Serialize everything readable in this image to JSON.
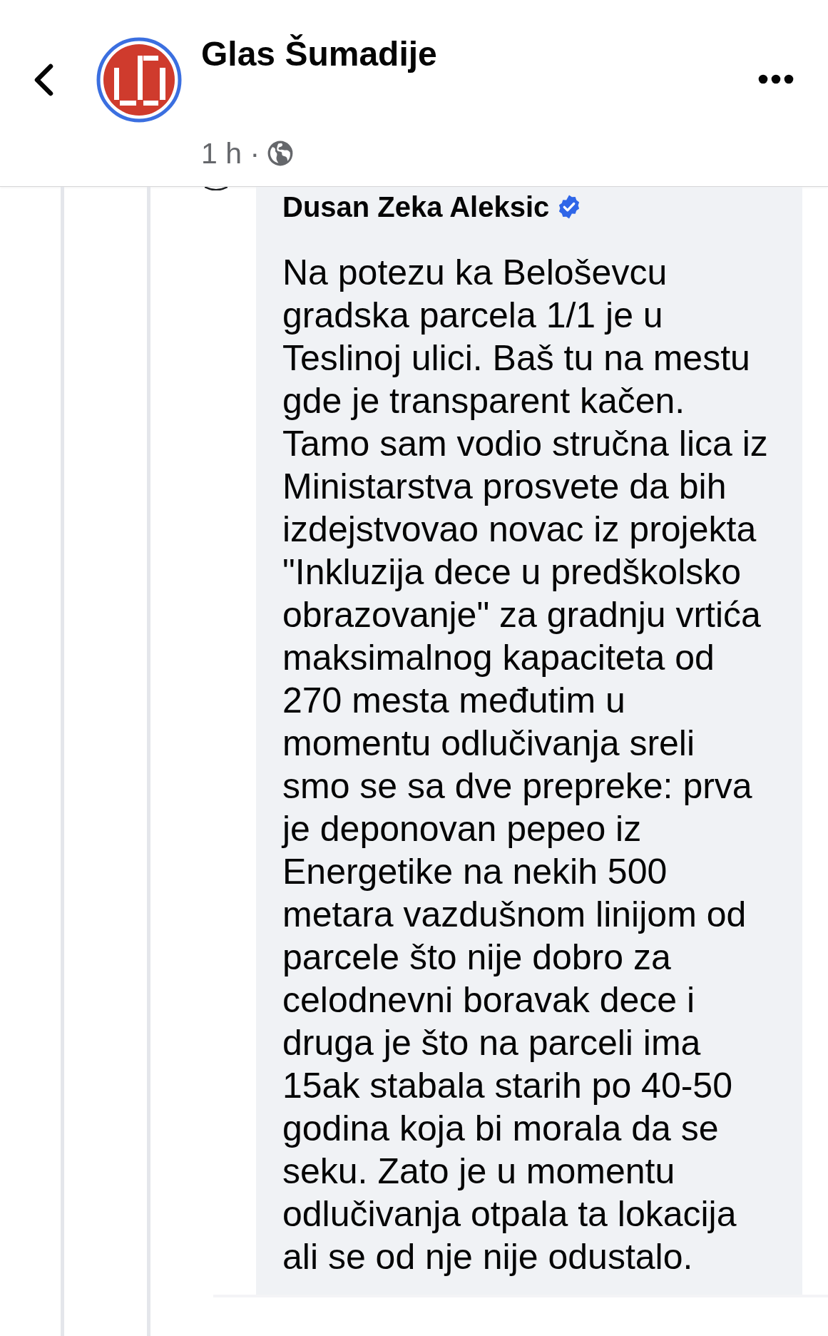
{
  "header": {
    "title": "Glas Šumadije",
    "meta": "1 h ·"
  },
  "comment": {
    "author": "Dusan Zeka Aleksic",
    "verified": true,
    "text": "Na potezu ka Beloševcu\ngradska parcela 1/1 je u\nTeslinoj ulici. Baš tu na mestu\ngde je transparent kačen.\nTamo sam vodio stručna lica iz\nMinistarstva prosvete da bih\nizdejstvovao novac iz projekta\n\"Inkluzija dece u predškolsko\nobrazovanje\" za gradnju vrtića\nmaksimalnog kapaciteta od\n270 mesta međutim u\nmomentu odlučivanja sreli\nsmo se sa dve prepreke: prva\nje deponovan pepeo iz\nEnergetike na nekih 500\nmetara vazdušnom linijom od\nparcele što nije dobro za\ncelodnevni boravak dece i\ndruga je što na parceli ima\n15ak stabala starih po 40-50\ngodina koja bi morala da se\nseku. Zato je u momentu\nodlučivanja otpala ta lokacija\nali se od nje nije odustalo."
  }
}
